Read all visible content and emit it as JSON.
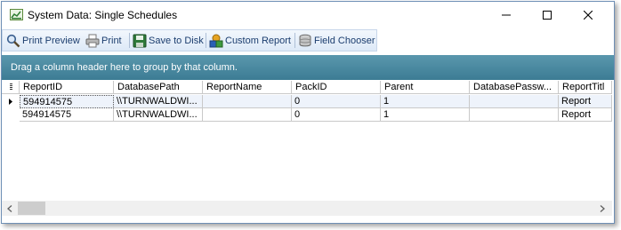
{
  "window": {
    "title": "System Data: Single Schedules",
    "icon": "chart-icon"
  },
  "toolbar": {
    "print_preview": "Print Preview",
    "print": "Print",
    "save_to_disk": "Save to Disk",
    "custom_report": "Custom Report",
    "field_chooser": "Field Chooser"
  },
  "group_panel": {
    "text": "Drag a column header here to group by that column."
  },
  "grid": {
    "columns": [
      "ReportID",
      "DatabasePath",
      "ReportName",
      "PackID",
      "Parent",
      "DatabasePassw...",
      "ReportTitl"
    ],
    "rows": [
      [
        "594914575",
        "\\\\TURNWALDWI...",
        "",
        "0",
        "1",
        "",
        "Report"
      ],
      [
        "594914575",
        "\\\\TURNWALDWI...",
        "",
        "0",
        "1",
        "",
        "Report"
      ]
    ]
  },
  "colors": {
    "group_panel": "#4a8aa2",
    "toolbar_text": "#1b3d6e",
    "window_border": "#6e8fb5"
  }
}
